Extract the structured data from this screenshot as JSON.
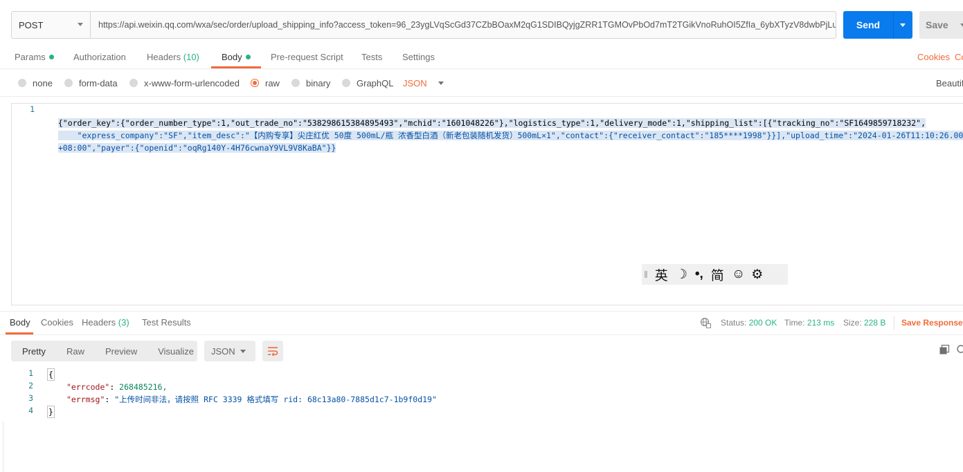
{
  "request": {
    "method": "POST",
    "url": "https://api.weixin.qq.com/wxa/sec/order/upload_shipping_info?access_token=96_23ygLVqScGd37CZbBOaxM2qG1SDIBQyjgZRR1TGMOvPbOd7mT2TGikVnoRuhOI5ZfIa_6ybXTyzV8dwbPjLu ...",
    "send_label": "Send",
    "save_label": "Save"
  },
  "request_tabs": {
    "params": "Params",
    "authorization": "Authorization",
    "headers": "Headers",
    "headers_count": "(10)",
    "body": "Body",
    "prerequest": "Pre-request Script",
    "tests": "Tests",
    "settings": "Settings",
    "cookies": "Cookies",
    "code": "Co"
  },
  "body_types": {
    "none": "none",
    "form_data": "form-data",
    "urlencoded": "x-www-form-urlencoded",
    "raw": "raw",
    "binary": "binary",
    "graphql": "GraphQL",
    "format": "JSON",
    "beautify": "Beautif"
  },
  "editor": {
    "line_number": "1",
    "line1": "{\"order_key\":{\"order_number_type\":1,\"out_trade_no\":\"538298615384895493\",\"mchid\":\"1601048226\"},\"logistics_type\":1,\"delivery_mode\":1,\"shipping_list\":[{\"tracking_no\":\"SF1649859718232\",",
    "line2": "    \"express_company\":\"SF\",\"item_desc\":\"【内购专享】尖庄红优 50度 500mL/瓶 浓香型白酒（新老包装随机发货）500mL×1\",\"contact\":{\"receiver_contact\":\"185****1998\"}}],\"upload_time\":\"2024-01-26T11:10:26.000",
    "line3": "+08:00\",\"payer\":{\"openid\":\"oqRg140Y-4H76cwnaY9VL9V8KaBA\"}}"
  },
  "ime": {
    "separator": "‖",
    "lang": "英",
    "moon": "☽",
    "punct": "•,",
    "mode": "简",
    "emoji": "☺",
    "settings": "⚙"
  },
  "response_tabs": {
    "body": "Body",
    "cookies": "Cookies",
    "headers": "Headers",
    "headers_count": "(3)",
    "test_results": "Test Results"
  },
  "response_meta": {
    "status_label": "Status:",
    "status_value": "200 OK",
    "time_label": "Time:",
    "time_value": "213 ms",
    "size_label": "Size:",
    "size_value": "228 B",
    "save_response": "Save Response"
  },
  "response_view": {
    "pretty": "Pretty",
    "raw": "Raw",
    "preview": "Preview",
    "visualize": "Visualize",
    "format": "JSON"
  },
  "response_body": {
    "lines": [
      {
        "num": "1",
        "text": "{"
      },
      {
        "num": "2",
        "key": "\"errcode\"",
        "value": "268485216,"
      },
      {
        "num": "3",
        "key": "\"errmsg\"",
        "value": "\"上传时间非法，请按照 RFC 3339 格式填写 rid: 68c13a80-7885d1c7-1b9f0d19\""
      },
      {
        "num": "4",
        "text": "}"
      }
    ]
  }
}
